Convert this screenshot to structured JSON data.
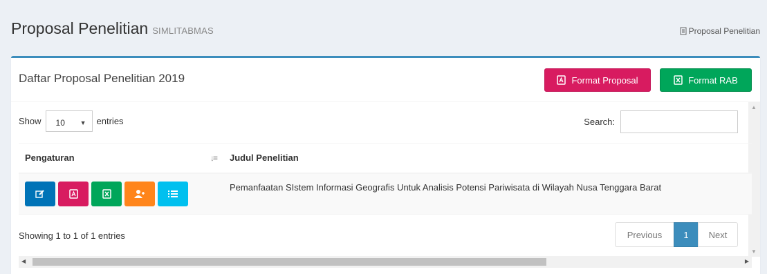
{
  "header": {
    "title": "Proposal Penelitian",
    "subtitle": "SIMLITABMAS",
    "breadcrumb": "Proposal Penelitian"
  },
  "box": {
    "title": "Daftar Proposal Penelitian 2019",
    "btn_format_proposal": "Format Proposal",
    "btn_format_rab": "Format RAB"
  },
  "controls": {
    "show_label": "Show",
    "entries_value": "10",
    "entries_label": "entries",
    "search_label": "Search:"
  },
  "table": {
    "columns": [
      "Pengaturan",
      "Judul Penelitian"
    ],
    "rows": [
      {
        "judul": "Pemanfaatan SIstem Informasi Geografis Untuk Analisis Potensi Pariwisata di Wilayah Nusa Tenggara Barat"
      }
    ],
    "action_icons": [
      "edit-icon",
      "pdf-icon",
      "excel-icon",
      "add-user-icon",
      "list-icon"
    ]
  },
  "footer": {
    "info": "Showing 1 to 1 of 1 entries",
    "prev": "Previous",
    "page": "1",
    "next": "Next"
  },
  "colors": {
    "primary": "#3c8dbc",
    "pink": "#d81b60",
    "green": "#00a65a",
    "blue": "#0073b7",
    "orange": "#ff851b",
    "cyan": "#00c0ef"
  }
}
